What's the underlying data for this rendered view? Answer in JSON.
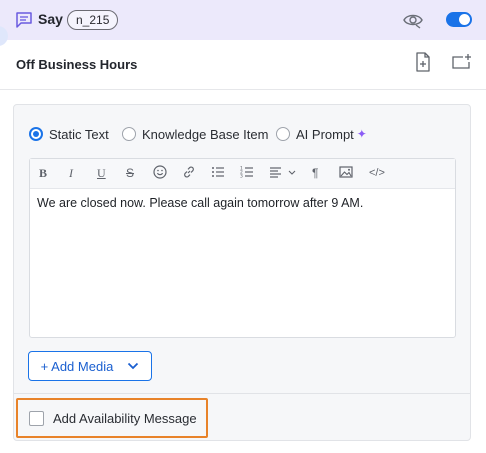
{
  "header": {
    "title": "Say",
    "node_id": "n_215",
    "enabled": true,
    "accent_color": "#1a73e8",
    "background_color": "#ece9fb"
  },
  "node": {
    "title": "Off Business Hours"
  },
  "content_source": {
    "options": [
      "Static Text",
      "Knowledge Base Item",
      "AI Prompt"
    ],
    "selected": "Static Text"
  },
  "editor": {
    "toolbar": {
      "bold": "B",
      "italic": "I",
      "underline": "U",
      "strike": "S",
      "paragraph": "¶",
      "code": "</>"
    },
    "text": "We are closed now. Please call again tomorrow after 9 AM."
  },
  "add_media": {
    "label": "+ Add Media"
  },
  "availability": {
    "label": "Add Availability Message",
    "checked": false,
    "highlight_color": "#e8832a"
  }
}
